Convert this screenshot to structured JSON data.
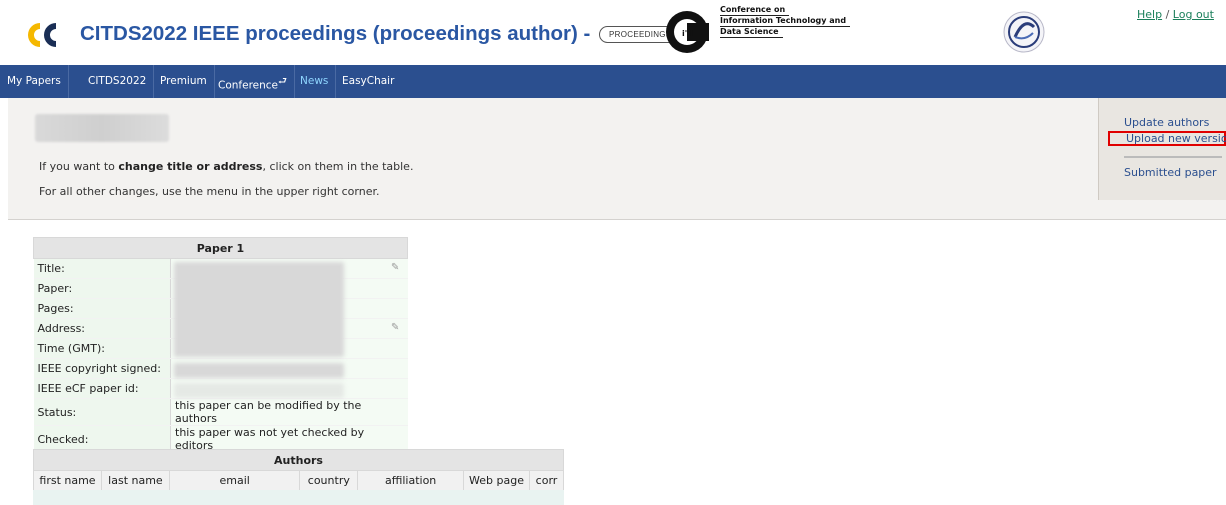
{
  "header": {
    "title": "CITDS2022 IEEE proceedings (proceedings author) -",
    "role_badge": "PROCEEDINGS",
    "conf_logo_lines": [
      "Conference on",
      "Information Technology and",
      "Data Science"
    ],
    "links": {
      "help": "Help",
      "separator": "/",
      "logout": "Log out"
    }
  },
  "nav": {
    "items": [
      {
        "label": "My Papers"
      },
      {
        "label": "CITDS2022"
      },
      {
        "label": "Premium"
      },
      {
        "label": "Conference"
      },
      {
        "label": "News"
      },
      {
        "label": "EasyChair"
      }
    ],
    "conference_glyph": "⮐"
  },
  "info": {
    "line1_pre": "If you want to ",
    "line1_bold": "change title or address",
    "line1_post": ", click on them in the table.",
    "line2": "For all other changes, use the menu in the upper right corner."
  },
  "side_menu": {
    "update_authors": "Update authors",
    "upload_new_version": "Upload new version",
    "submitted_paper": "Submitted paper"
  },
  "paper_table": {
    "title": "Paper 1",
    "rows": [
      {
        "label": "Title:",
        "value": ""
      },
      {
        "label": "Paper:",
        "value": ""
      },
      {
        "label": "Pages:",
        "value": ""
      },
      {
        "label": "Address:",
        "value": ""
      },
      {
        "label": "Time (GMT):",
        "value": ""
      },
      {
        "label": "IEEE copyright signed:",
        "value": ""
      },
      {
        "label": "IEEE eCF paper id:",
        "value": ""
      },
      {
        "label": "Status:",
        "value": "this paper can be modified by the authors"
      },
      {
        "label": "Checked:",
        "value": "this paper was not yet checked by editors"
      }
    ]
  },
  "authors_table": {
    "title": "Authors",
    "columns": [
      "first name",
      "last name",
      "email",
      "country",
      "affiliation",
      "Web page",
      "corr"
    ]
  },
  "colors": {
    "nav_bg": "#2b4f8f",
    "title_blue": "#2a57a3",
    "ec_yellow": "#f5b800",
    "highlight_red": "#e00000"
  }
}
